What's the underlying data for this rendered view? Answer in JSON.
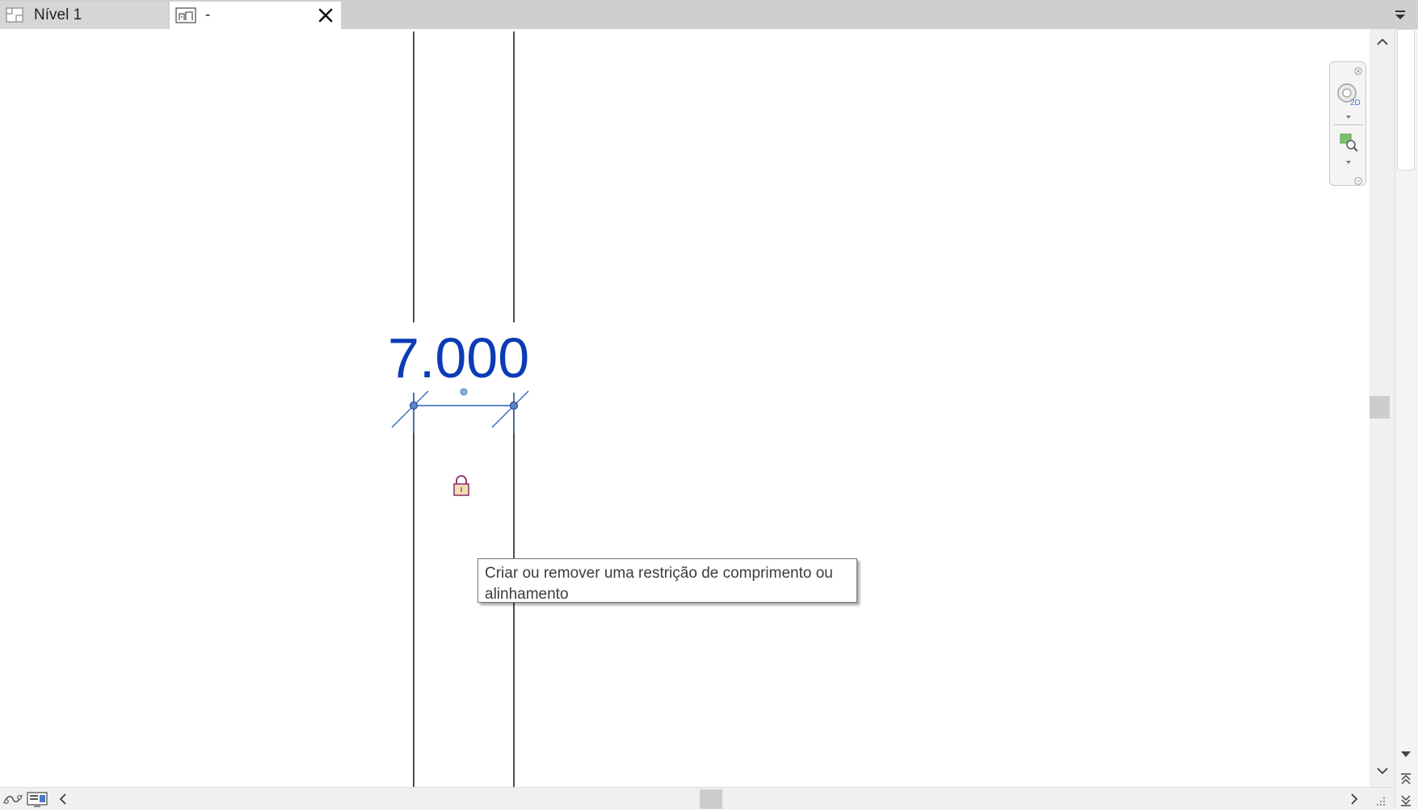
{
  "tabs": [
    {
      "label": "Nível 1",
      "icon": "floor-plan-icon"
    },
    {
      "label": "-",
      "icon": "elevation-view-icon",
      "active": true
    }
  ],
  "canvas": {
    "dimension_value": "7.000",
    "dimension_color": "#0b3cb5",
    "tooltip": "Criar ou remover uma restrição de comprimento ou alinhamento"
  },
  "navigation_bar": {
    "wheel_label": "2D",
    "items": [
      "2d-steering-wheel-icon",
      "zoom-region-icon"
    ]
  },
  "colors": {
    "tabbar": "#cfcfcf",
    "dimension": "#0b3cb5",
    "lock": "#8b2a6b"
  }
}
